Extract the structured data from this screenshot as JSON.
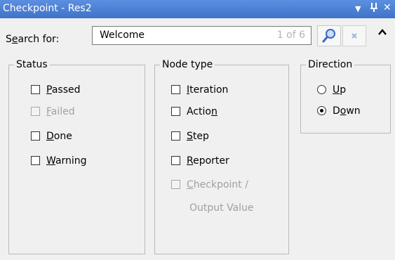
{
  "window": {
    "title": "Checkpoint - Res2",
    "buttons": {
      "dropdown_glyph": "▼",
      "pin_glyph": "ᵖ",
      "close_glyph": "✕"
    }
  },
  "search": {
    "label_pre": "S",
    "label_u": "e",
    "label_post": "arch for:",
    "value": "Welcome",
    "match_count": "1 of 6",
    "find_icon": "search-icon",
    "clear_icon": "clear-icon",
    "collapse_icon": "chevron-up-icon"
  },
  "status": {
    "legend": "Status",
    "items": [
      {
        "pre": "",
        "u": "P",
        "post": "assed",
        "checked": false,
        "enabled": true
      },
      {
        "pre": "",
        "u": "F",
        "post": "ailed",
        "checked": false,
        "enabled": false
      },
      {
        "pre": "",
        "u": "D",
        "post": "one",
        "checked": false,
        "enabled": true
      },
      {
        "pre": "",
        "u": "W",
        "post": "arning",
        "checked": false,
        "enabled": true
      }
    ]
  },
  "node_type": {
    "legend": "Node type",
    "items": [
      {
        "pre": "",
        "u": "I",
        "post": "teration",
        "checked": false,
        "enabled": true
      },
      {
        "pre": "Actio",
        "u": "n",
        "post": "",
        "checked": false,
        "enabled": true
      },
      {
        "pre": "",
        "u": "S",
        "post": "tep",
        "checked": false,
        "enabled": true
      },
      {
        "pre": "",
        "u": "R",
        "post": "eporter",
        "checked": false,
        "enabled": true
      },
      {
        "pre": "",
        "u": "C",
        "post": "heckpoint /",
        "line2": "Output Value",
        "checked": false,
        "enabled": false
      }
    ]
  },
  "direction": {
    "legend": "Direction",
    "options": [
      {
        "pre": "",
        "u": "U",
        "post": "p",
        "selected": false
      },
      {
        "pre": "D",
        "u": "o",
        "post": "wn",
        "selected": true
      }
    ]
  }
}
